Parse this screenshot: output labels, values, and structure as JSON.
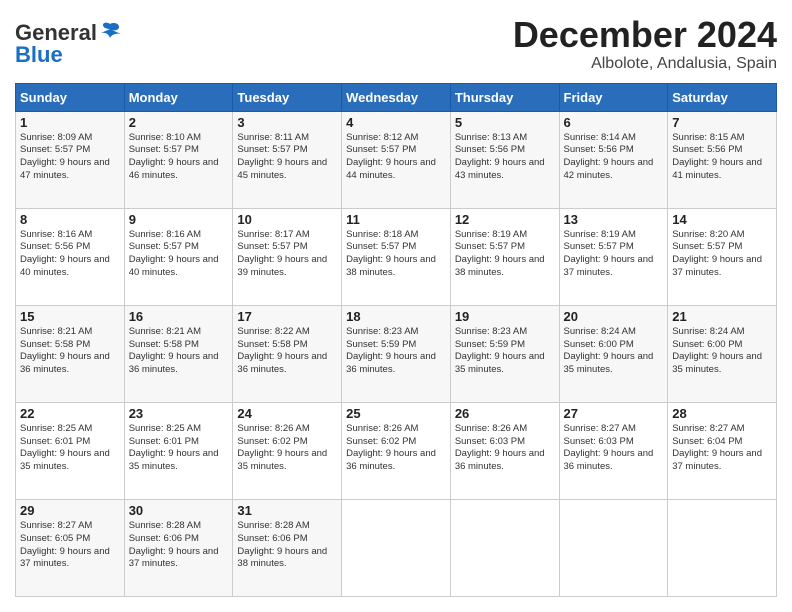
{
  "logo": {
    "line1": "General",
    "line2": "Blue"
  },
  "header": {
    "month": "December 2024",
    "location": "Albolote, Andalusia, Spain"
  },
  "weekdays": [
    "Sunday",
    "Monday",
    "Tuesday",
    "Wednesday",
    "Thursday",
    "Friday",
    "Saturday"
  ],
  "weeks": [
    [
      {
        "day": "1",
        "sunrise": "Sunrise: 8:09 AM",
        "sunset": "Sunset: 5:57 PM",
        "daylight": "Daylight: 9 hours and 47 minutes."
      },
      {
        "day": "2",
        "sunrise": "Sunrise: 8:10 AM",
        "sunset": "Sunset: 5:57 PM",
        "daylight": "Daylight: 9 hours and 46 minutes."
      },
      {
        "day": "3",
        "sunrise": "Sunrise: 8:11 AM",
        "sunset": "Sunset: 5:57 PM",
        "daylight": "Daylight: 9 hours and 45 minutes."
      },
      {
        "day": "4",
        "sunrise": "Sunrise: 8:12 AM",
        "sunset": "Sunset: 5:57 PM",
        "daylight": "Daylight: 9 hours and 44 minutes."
      },
      {
        "day": "5",
        "sunrise": "Sunrise: 8:13 AM",
        "sunset": "Sunset: 5:56 PM",
        "daylight": "Daylight: 9 hours and 43 minutes."
      },
      {
        "day": "6",
        "sunrise": "Sunrise: 8:14 AM",
        "sunset": "Sunset: 5:56 PM",
        "daylight": "Daylight: 9 hours and 42 minutes."
      },
      {
        "day": "7",
        "sunrise": "Sunrise: 8:15 AM",
        "sunset": "Sunset: 5:56 PM",
        "daylight": "Daylight: 9 hours and 41 minutes."
      }
    ],
    [
      {
        "day": "8",
        "sunrise": "Sunrise: 8:16 AM",
        "sunset": "Sunset: 5:56 PM",
        "daylight": "Daylight: 9 hours and 40 minutes."
      },
      {
        "day": "9",
        "sunrise": "Sunrise: 8:16 AM",
        "sunset": "Sunset: 5:57 PM",
        "daylight": "Daylight: 9 hours and 40 minutes."
      },
      {
        "day": "10",
        "sunrise": "Sunrise: 8:17 AM",
        "sunset": "Sunset: 5:57 PM",
        "daylight": "Daylight: 9 hours and 39 minutes."
      },
      {
        "day": "11",
        "sunrise": "Sunrise: 8:18 AM",
        "sunset": "Sunset: 5:57 PM",
        "daylight": "Daylight: 9 hours and 38 minutes."
      },
      {
        "day": "12",
        "sunrise": "Sunrise: 8:19 AM",
        "sunset": "Sunset: 5:57 PM",
        "daylight": "Daylight: 9 hours and 38 minutes."
      },
      {
        "day": "13",
        "sunrise": "Sunrise: 8:19 AM",
        "sunset": "Sunset: 5:57 PM",
        "daylight": "Daylight: 9 hours and 37 minutes."
      },
      {
        "day": "14",
        "sunrise": "Sunrise: 8:20 AM",
        "sunset": "Sunset: 5:57 PM",
        "daylight": "Daylight: 9 hours and 37 minutes."
      }
    ],
    [
      {
        "day": "15",
        "sunrise": "Sunrise: 8:21 AM",
        "sunset": "Sunset: 5:58 PM",
        "daylight": "Daylight: 9 hours and 36 minutes."
      },
      {
        "day": "16",
        "sunrise": "Sunrise: 8:21 AM",
        "sunset": "Sunset: 5:58 PM",
        "daylight": "Daylight: 9 hours and 36 minutes."
      },
      {
        "day": "17",
        "sunrise": "Sunrise: 8:22 AM",
        "sunset": "Sunset: 5:58 PM",
        "daylight": "Daylight: 9 hours and 36 minutes."
      },
      {
        "day": "18",
        "sunrise": "Sunrise: 8:23 AM",
        "sunset": "Sunset: 5:59 PM",
        "daylight": "Daylight: 9 hours and 36 minutes."
      },
      {
        "day": "19",
        "sunrise": "Sunrise: 8:23 AM",
        "sunset": "Sunset: 5:59 PM",
        "daylight": "Daylight: 9 hours and 35 minutes."
      },
      {
        "day": "20",
        "sunrise": "Sunrise: 8:24 AM",
        "sunset": "Sunset: 6:00 PM",
        "daylight": "Daylight: 9 hours and 35 minutes."
      },
      {
        "day": "21",
        "sunrise": "Sunrise: 8:24 AM",
        "sunset": "Sunset: 6:00 PM",
        "daylight": "Daylight: 9 hours and 35 minutes."
      }
    ],
    [
      {
        "day": "22",
        "sunrise": "Sunrise: 8:25 AM",
        "sunset": "Sunset: 6:01 PM",
        "daylight": "Daylight: 9 hours and 35 minutes."
      },
      {
        "day": "23",
        "sunrise": "Sunrise: 8:25 AM",
        "sunset": "Sunset: 6:01 PM",
        "daylight": "Daylight: 9 hours and 35 minutes."
      },
      {
        "day": "24",
        "sunrise": "Sunrise: 8:26 AM",
        "sunset": "Sunset: 6:02 PM",
        "daylight": "Daylight: 9 hours and 35 minutes."
      },
      {
        "day": "25",
        "sunrise": "Sunrise: 8:26 AM",
        "sunset": "Sunset: 6:02 PM",
        "daylight": "Daylight: 9 hours and 36 minutes."
      },
      {
        "day": "26",
        "sunrise": "Sunrise: 8:26 AM",
        "sunset": "Sunset: 6:03 PM",
        "daylight": "Daylight: 9 hours and 36 minutes."
      },
      {
        "day": "27",
        "sunrise": "Sunrise: 8:27 AM",
        "sunset": "Sunset: 6:03 PM",
        "daylight": "Daylight: 9 hours and 36 minutes."
      },
      {
        "day": "28",
        "sunrise": "Sunrise: 8:27 AM",
        "sunset": "Sunset: 6:04 PM",
        "daylight": "Daylight: 9 hours and 37 minutes."
      }
    ],
    [
      {
        "day": "29",
        "sunrise": "Sunrise: 8:27 AM",
        "sunset": "Sunset: 6:05 PM",
        "daylight": "Daylight: 9 hours and 37 minutes."
      },
      {
        "day": "30",
        "sunrise": "Sunrise: 8:28 AM",
        "sunset": "Sunset: 6:06 PM",
        "daylight": "Daylight: 9 hours and 37 minutes."
      },
      {
        "day": "31",
        "sunrise": "Sunrise: 8:28 AM",
        "sunset": "Sunset: 6:06 PM",
        "daylight": "Daylight: 9 hours and 38 minutes."
      },
      null,
      null,
      null,
      null
    ]
  ]
}
